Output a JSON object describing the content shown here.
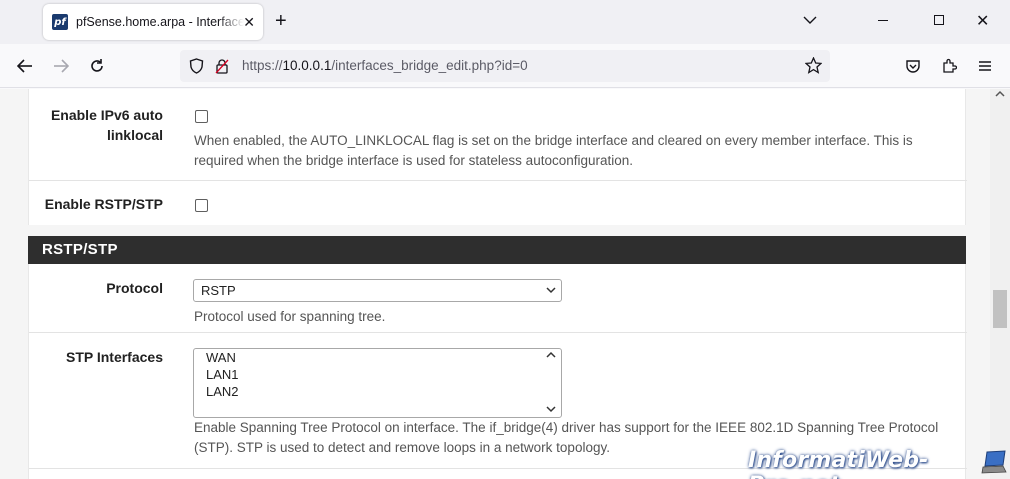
{
  "browser": {
    "tab_title": "pfSense.home.arpa - Interfaces: Bridges: Edit",
    "favicon_text": "pf",
    "url_prefix": "https://",
    "url_host": "10.0.0.1",
    "url_path": "/interfaces_bridge_edit.php?id=0",
    "icons": [
      "back-icon",
      "forward-icon",
      "reload-icon",
      "shield-icon",
      "lock-icon",
      "bookmark-star-icon",
      "pocket-icon",
      "extensions-icon",
      "menu-icon",
      "new-tab-icon",
      "tab-list-icon",
      "minimize-icon",
      "maximize-icon",
      "close-icon"
    ]
  },
  "form": {
    "ipv6_linklocal": {
      "label_line1": "Enable IPv6 auto",
      "label_line2": "linklocal",
      "checked": false,
      "help_line1": "When enabled, the AUTO_LINKLOCAL flag is set on the bridge interface and cleared on every member interface. This is",
      "help_line2": "required when the bridge interface is used for stateless autoconfiguration."
    },
    "rstp_stp": {
      "label": "Enable RSTP/STP",
      "checked": false
    }
  },
  "section_rstp": {
    "title": "RSTP/STP",
    "protocol": {
      "label": "Protocol",
      "value": "RSTP",
      "help": "Protocol used for spanning tree."
    },
    "stp_interfaces": {
      "label": "STP Interfaces",
      "options": [
        "WAN",
        "LAN1",
        "LAN2"
      ],
      "help_line1": "Enable Spanning Tree Protocol on interface. The if_bridge(4) driver has support for the IEEE 802.1D Spanning Tree Protocol",
      "help_line2": "(STP). STP is used to detect and remove loops in a network topology."
    }
  },
  "watermark": "InformatiWeb-Pro.net"
}
